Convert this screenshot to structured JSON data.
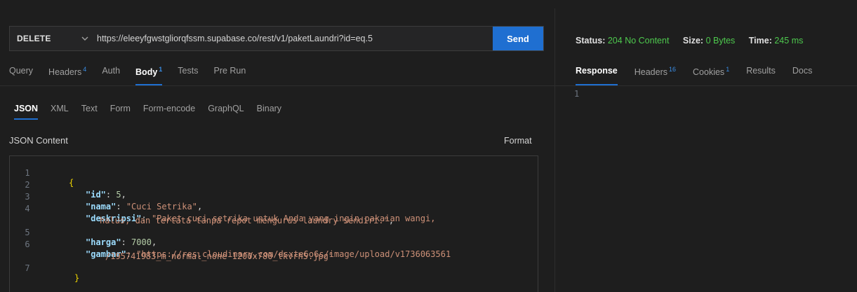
{
  "request": {
    "method": "DELETE",
    "url": "https://eleeyfgwstgliorqfssm.supabase.co/rest/v1/paketLaundri?id=eq.5",
    "send_label": "Send"
  },
  "request_tabs": [
    {
      "label": "Query",
      "badge": ""
    },
    {
      "label": "Headers",
      "badge": "4"
    },
    {
      "label": "Auth",
      "badge": ""
    },
    {
      "label": "Body",
      "badge": "1"
    },
    {
      "label": "Tests",
      "badge": ""
    },
    {
      "label": "Pre Run",
      "badge": ""
    }
  ],
  "body_tabs": [
    "JSON",
    "XML",
    "Text",
    "Form",
    "Form-encode",
    "GraphQL",
    "Binary"
  ],
  "json_content_label": "JSON Content",
  "format_label": "Format",
  "editor": {
    "line_numbers": [
      "1",
      "2",
      "3",
      "4",
      "",
      "5",
      "6",
      "",
      "7"
    ],
    "l1": "{",
    "l2_key": "\"id\"",
    "l2_val": "5",
    "l3_key": "\"nama\"",
    "l3_val": "\"Cuci Setrika\"",
    "l4_key": "\"deskripsi\"",
    "l4_val_a": "\"Paket cuci setrika untuk Anda yang ingin pakaian wangi,",
    "l4_val_b": "halus, dan tertata tanpa repot mengurus laundry sendiri.\"",
    "l5_key": "\"harga\"",
    "l5_val": "7000",
    "l6_key": "\"gambar\"",
    "l6_val_a": "\"https://res.cloudinary.com/dsxte6o6s/image/upload/v1736063561",
    "l6_val_b": "/195741983_m_normal_none-1200x780_tkvrh5.jpg\"",
    "l7": "}"
  },
  "response_status": {
    "status_label": "Status:",
    "status_value": "204 No Content",
    "size_label": "Size:",
    "size_value": "0 Bytes",
    "time_label": "Time:",
    "time_value": "245 ms"
  },
  "response_tabs": [
    {
      "label": "Response",
      "badge": ""
    },
    {
      "label": "Headers",
      "badge": "16"
    },
    {
      "label": "Cookies",
      "badge": "1"
    },
    {
      "label": "Results",
      "badge": ""
    },
    {
      "label": "Docs",
      "badge": ""
    }
  ],
  "response_body_line": "1",
  "colors": {
    "accent": "#1f6fd1",
    "status_ok": "#4ec94e",
    "badge": "#3a8ee6"
  }
}
